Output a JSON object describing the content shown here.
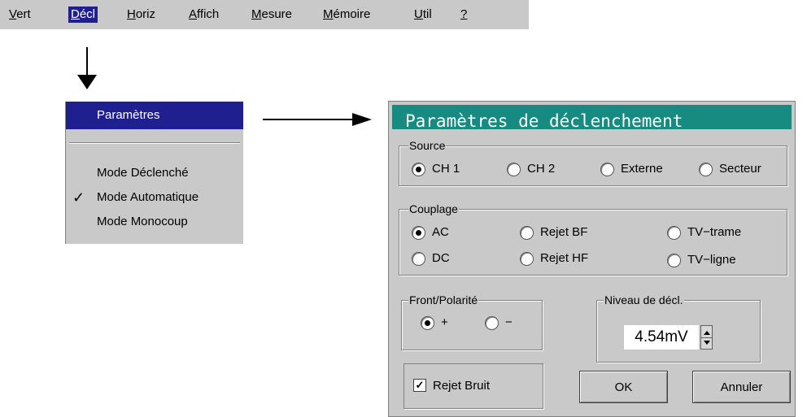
{
  "menubar": {
    "items": [
      {
        "mnemonic": "V",
        "rest": "ert"
      },
      {
        "mnemonic": "D",
        "rest": "écl"
      },
      {
        "mnemonic": "H",
        "rest": "oriz"
      },
      {
        "mnemonic": "A",
        "rest": "ffich"
      },
      {
        "mnemonic": "M",
        "rest": "esure"
      },
      {
        "mnemonic": "M",
        "rest": "émoire"
      },
      {
        "mnemonic": "U",
        "rest": "til"
      },
      {
        "mnemonic": "?",
        "rest": ""
      }
    ],
    "active_index": 1
  },
  "dropdown": {
    "items": [
      {
        "label": "Paramètres"
      },
      {
        "label": "Mode Déclenché"
      },
      {
        "label": "Mode Automatique",
        "check": "✓"
      },
      {
        "label": "Mode Monocoup"
      }
    ]
  },
  "dialog": {
    "title": "Paramètres de déclenchement",
    "source": {
      "label": "Source",
      "options": [
        "CH 1",
        "CH 2",
        "Externe",
        "Secteur"
      ],
      "selected": "CH 1"
    },
    "couplage": {
      "label": "Couplage",
      "options": [
        "AC",
        "DC",
        "Rejet BF",
        "Rejet HF",
        "TV−trame",
        "TV−ligne"
      ],
      "selected": "AC"
    },
    "front": {
      "label": "Front/Polarité",
      "options": [
        "+",
        "−"
      ],
      "selected": "+"
    },
    "niveau": {
      "label": "Niveau de décl.",
      "value": "4.54mV"
    },
    "rejet_bruit": {
      "label": "Rejet Bruit",
      "checked": true,
      "check_glyph": "✓"
    },
    "buttons": {
      "ok": "OK",
      "cancel": "Annuler"
    }
  },
  "colors": {
    "menu_bg": "#c9c9c9",
    "highlight": "#1f1f8f",
    "title_bar": "#178b82"
  },
  "icons": [
    "arrow-down-icon",
    "arrow-right-icon",
    "checkmark-icon",
    "spin-up-icon",
    "spin-down-icon"
  ]
}
